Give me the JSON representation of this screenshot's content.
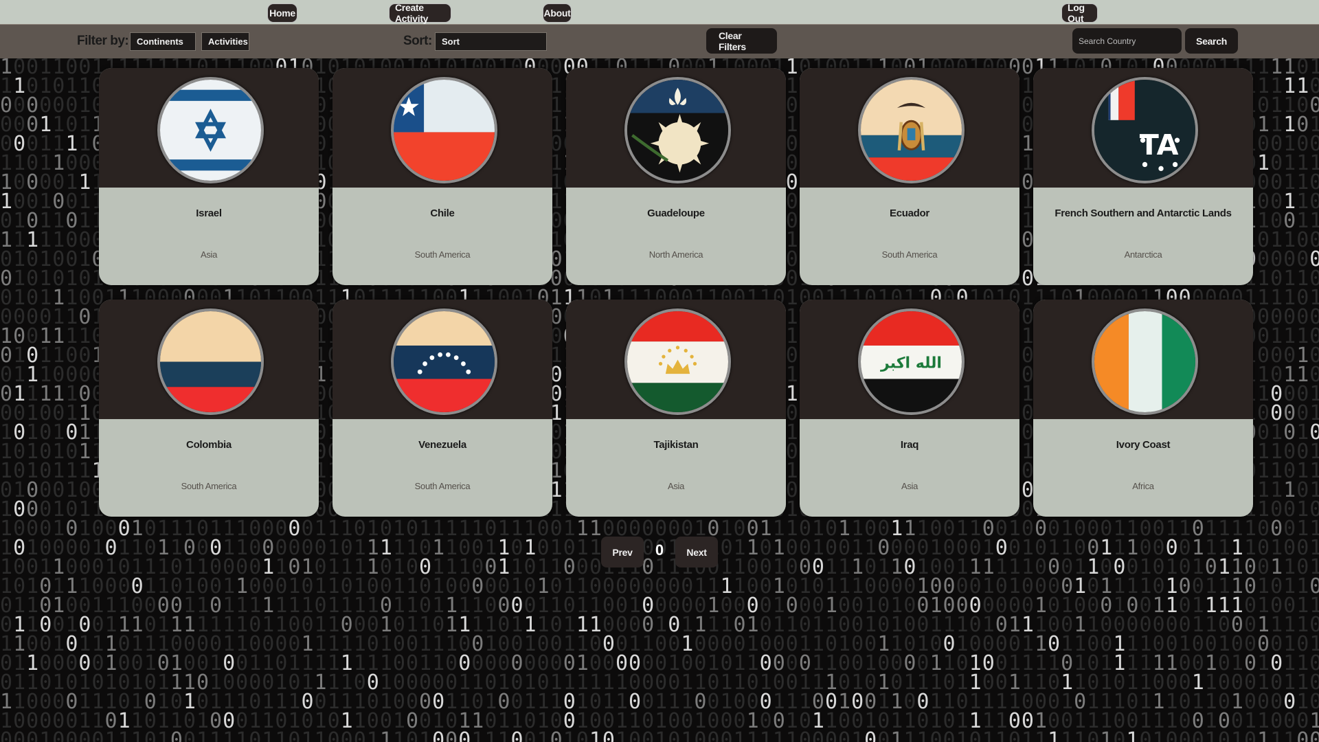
{
  "nav": {
    "home": "Home",
    "create_activity": "Create Activity",
    "about": "About",
    "logout": "Log Out"
  },
  "filters": {
    "filter_label": "Filter by:",
    "continents": "Continents",
    "activities": "Activities",
    "sort_label": "Sort:",
    "sort_value": "Sort",
    "clear": "Clear Filters",
    "search_placeholder": "Search Country",
    "search_button": "Search"
  },
  "countries": [
    {
      "name": "Israel",
      "continent": "Asia",
      "flag": "israel-flag-icon"
    },
    {
      "name": "Chile",
      "continent": "South America",
      "flag": "chile-flag-icon"
    },
    {
      "name": "Guadeloupe",
      "continent": "North America",
      "flag": "guadeloupe-flag-icon"
    },
    {
      "name": "Ecuador",
      "continent": "South America",
      "flag": "ecuador-flag-icon"
    },
    {
      "name": "French Southern and Antarctic Lands",
      "continent": "Antarctica",
      "flag": "french-southern-lands-flag-icon"
    },
    {
      "name": "Colombia",
      "continent": "South America",
      "flag": "colombia-flag-icon"
    },
    {
      "name": "Venezuela",
      "continent": "South America",
      "flag": "venezuela-flag-icon"
    },
    {
      "name": "Tajikistan",
      "continent": "Asia",
      "flag": "tajikistan-flag-icon"
    },
    {
      "name": "Iraq",
      "continent": "Asia",
      "flag": "iraq-flag-icon"
    },
    {
      "name": "Ivory Coast",
      "continent": "Africa",
      "flag": "ivory-coast-flag-icon"
    }
  ],
  "pagination": {
    "prev": "Prev",
    "page": "0",
    "next": "Next"
  },
  "flag_text": {
    "iraq": "الله اكبر"
  },
  "colors": {
    "nav_bg": "#c4cbc2",
    "filter_bg": "#5e5650",
    "card_top": "#2a2321",
    "card_bottom": "#bcc2b9",
    "button_bg": "#2c2524"
  }
}
